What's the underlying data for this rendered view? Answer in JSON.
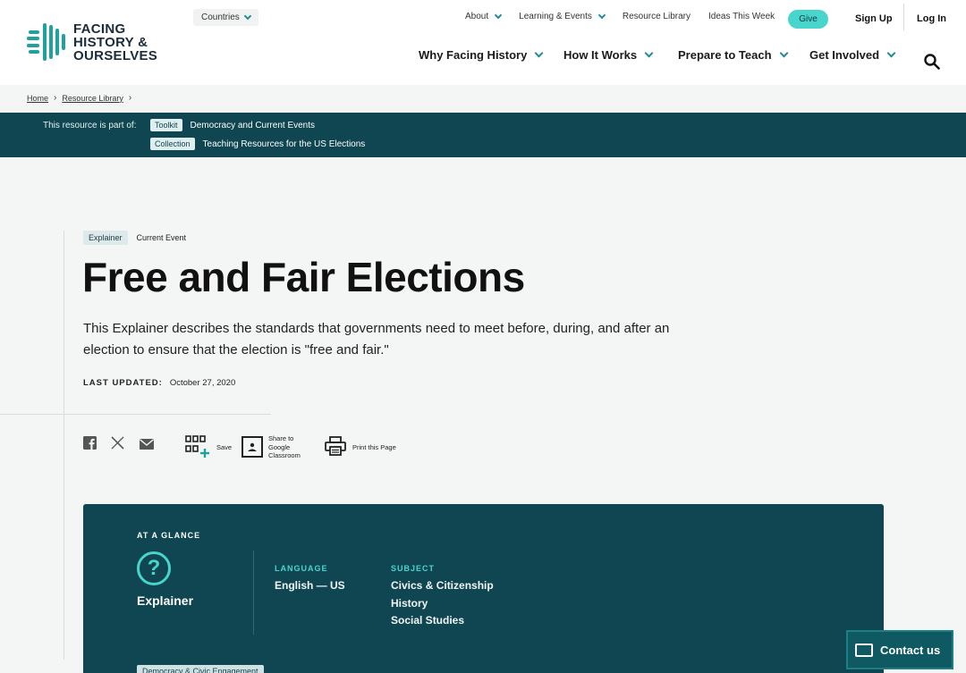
{
  "header": {
    "logo_lines": [
      "FACING",
      "HISTORY &",
      "OURSELVES"
    ],
    "countries_label": "Countries",
    "utility_nav": [
      "About",
      "Learning & Events",
      "Resource Library",
      "Ideas This Week"
    ],
    "give_label": "Give",
    "signup_label": "Sign Up",
    "login_label": "Log In",
    "main_nav": [
      "Why Facing History",
      "How It Works",
      "Prepare to Teach",
      "Get Involved"
    ],
    "accent_color": "#47d5cc"
  },
  "breadcrumb": {
    "items": [
      "Home",
      "Resource Library"
    ]
  },
  "resource_bar": {
    "lead": "This resource is part of:",
    "rows": [
      {
        "tag": "Toolkit",
        "text": "Democracy and Current Events"
      },
      {
        "tag": "Collection",
        "text": "Teaching Resources for the US Elections"
      }
    ],
    "background": "#0f4652"
  },
  "article": {
    "tags": [
      "Explainer",
      "Current Event"
    ],
    "title": "Free and Fair Elections",
    "description": "This Explainer describes the standards that governments need to meet before, during, and after an election to ensure that the election is \"free and fair.\"",
    "updated_label": "LAST UPDATED:",
    "updated_date": "October 27, 2020"
  },
  "share": {
    "save_label": "Save",
    "classroom_label_lines": [
      "Share to",
      "Google",
      "Classroom"
    ],
    "print_label": "Print this Page",
    "icons": [
      "facebook-icon",
      "x-icon",
      "email-icon",
      "save-grid-icon",
      "google-classroom-icon",
      "print-icon"
    ]
  },
  "glance": {
    "heading": "AT A GLANCE",
    "type": "Explainer",
    "language_heading": "LANGUAGE",
    "language": "English — US",
    "subject_heading": "SUBJECT",
    "subjects": [
      "Civics & Citizenship",
      "History",
      "Social Studies"
    ],
    "bottom_tag": "Democracy & Civic Engagement"
  },
  "contact": {
    "label": "Contact us"
  }
}
